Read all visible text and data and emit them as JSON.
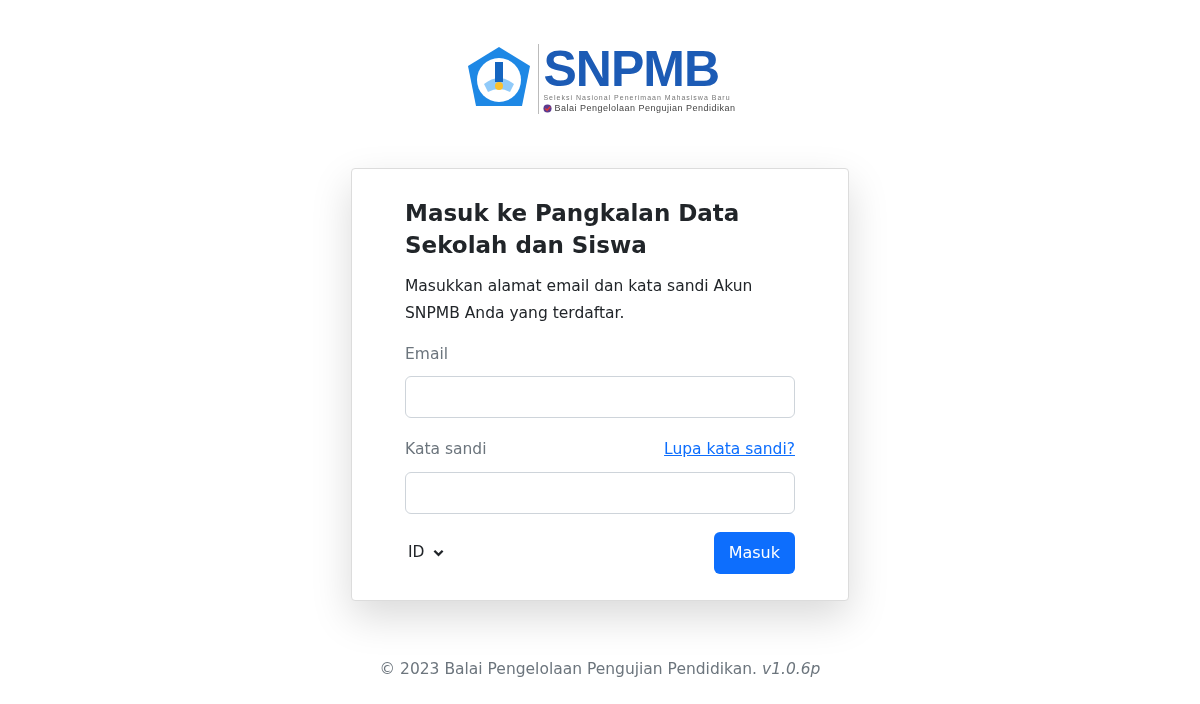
{
  "logo": {
    "name": "SNPMB",
    "tagline": "Seleksi Nasional Penerimaan Mahasiswa Baru",
    "org": "Balai Pengelolaan Pengujian Pendidikan"
  },
  "card": {
    "title": "Masuk ke Pangkalan Data Sekolah dan Siswa",
    "description": "Masukkan alamat email dan kata sandi Akun SNPMB Anda yang terdaftar.",
    "fields": [
      {
        "label": "Email"
      },
      {
        "label": "Kata sandi",
        "link": "Lupa kata sandi?"
      }
    ],
    "language": "ID",
    "submit": "Masuk"
  },
  "footer": "© 2023 Balai Pengelolaan Pengujian Pendidikan. *v1.0.6p*"
}
